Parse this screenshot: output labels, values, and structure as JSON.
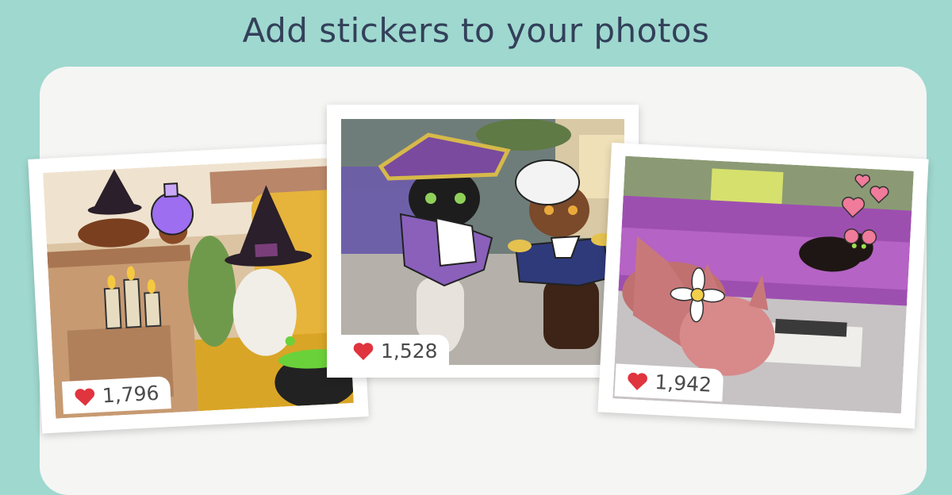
{
  "headline": "Add stickers to your photos",
  "posts": [
    {
      "likes": "1,796",
      "icon": "heart-icon",
      "heart_color": "#e0343f"
    },
    {
      "likes": "1,528",
      "icon": "heart-icon",
      "heart_color": "#e0343f"
    },
    {
      "likes": "1,942",
      "icon": "heart-icon",
      "heart_color": "#e0343f"
    }
  ],
  "colors": {
    "background": "#9fd8cf",
    "panel": "#f5f5f4",
    "headline": "#33405a"
  }
}
